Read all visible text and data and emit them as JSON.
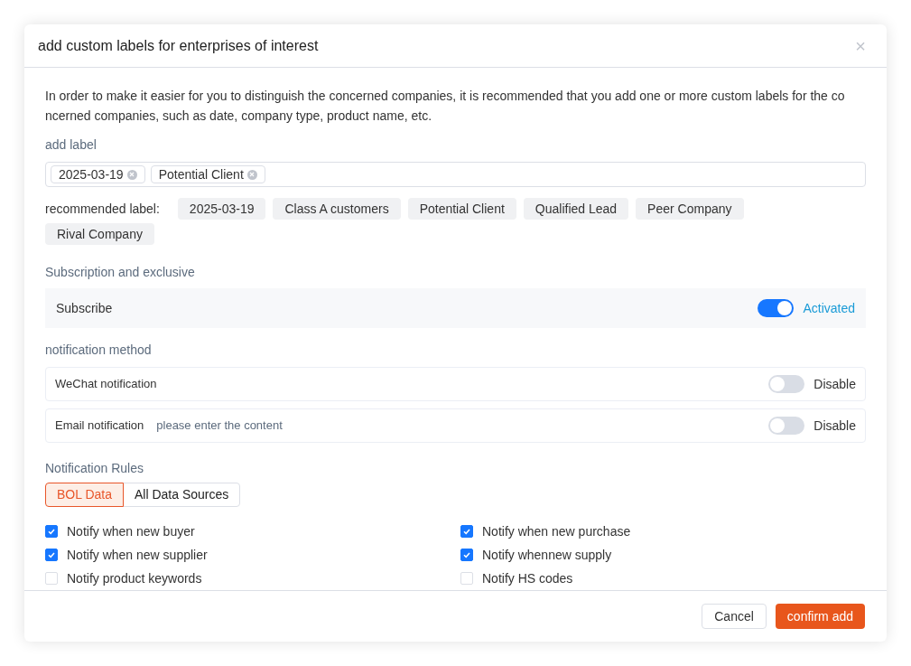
{
  "dialog": {
    "title": "add custom labels for enterprises of interest",
    "close": "×"
  },
  "intro": "In order to make it easier for you to distinguish the concerned companies, it is recommended that you add one or more custom labels for the concerned companies, such as date, company type, product name, etc.",
  "add_label": {
    "heading": "add label",
    "tags": [
      "2025-03-19",
      "Potential Client"
    ]
  },
  "recommended": {
    "label": "recommended label:",
    "tags": [
      "2025-03-19",
      "Class A customers",
      "Potential Client",
      "Qualified Lead",
      "Peer Company",
      "Rival Company"
    ]
  },
  "subscription": {
    "heading": "Subscription and exclusive",
    "label": "Subscribe",
    "on": true,
    "status": "Activated"
  },
  "notification_method": {
    "heading": "notification method",
    "rows": [
      {
        "label": "WeChat notification",
        "on": false,
        "status": "Disable"
      },
      {
        "label": "Email notification",
        "placeholder": "please enter the content",
        "on": false,
        "status": "Disable"
      }
    ]
  },
  "rules": {
    "heading": "Notification Rules",
    "tabs": [
      {
        "label": "BOL Data",
        "selected": true
      },
      {
        "label": "All Data Sources",
        "selected": false
      }
    ],
    "options": [
      {
        "label": "Notify when new buyer",
        "checked": true
      },
      {
        "label": "Notify when new purchase",
        "checked": true
      },
      {
        "label": "Notify when new supplier",
        "checked": true
      },
      {
        "label": "Notify whennew supply",
        "checked": true
      },
      {
        "label": "Notify product keywords",
        "checked": false
      },
      {
        "label": "Notify HS codes",
        "checked": false
      }
    ]
  },
  "footer": {
    "cancel": "Cancel",
    "confirm": "confirm add"
  }
}
